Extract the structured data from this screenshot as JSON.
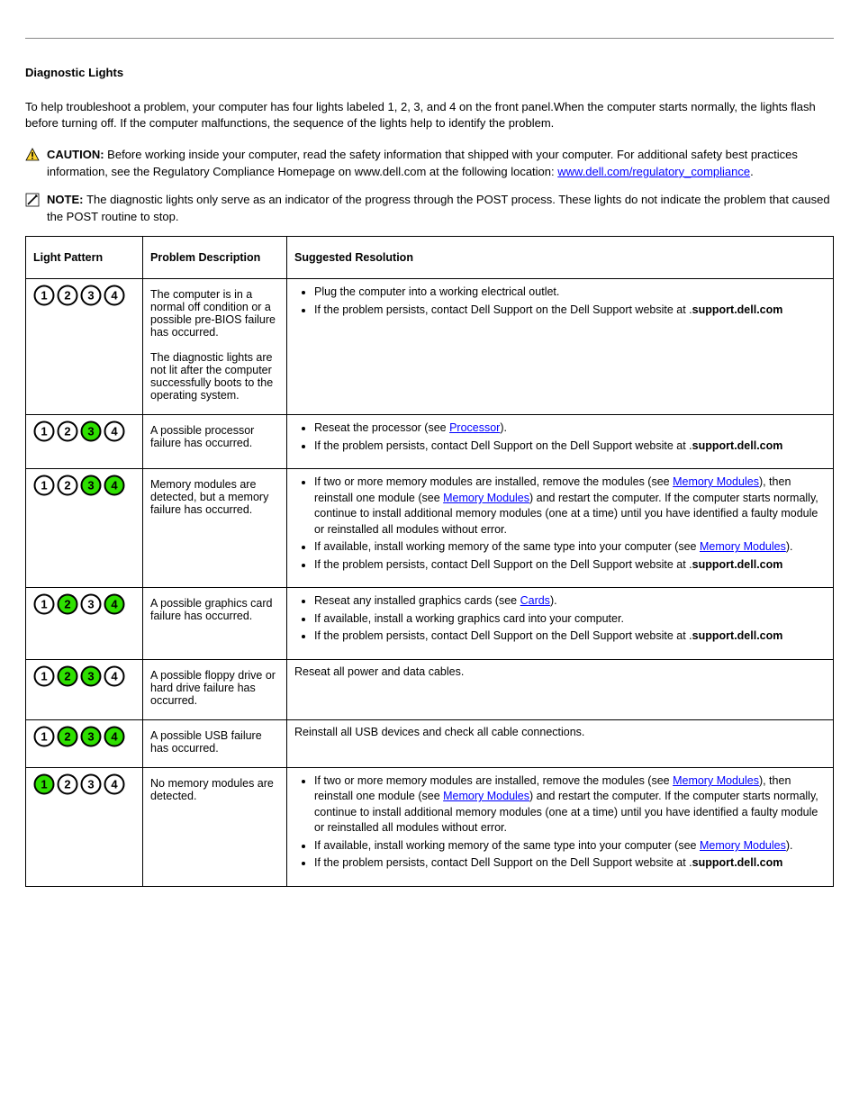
{
  "subtitle": "Diagnostic Lights",
  "lead": "To help troubleshoot a problem, your computer has four lights labeled 1, 2, 3, and 4 on the front panel.When the computer starts normally, the lights flash before turning off. If the computer malfunctions, the sequence of the lights help to identify the problem.",
  "caution": {
    "label": "CAUTION: ",
    "text_before": "Before working inside your computer, read the safety information that shipped with your computer. For additional safety best practices information, see the Regulatory Compliance Homepage on www.dell.com at the following location: ",
    "link": "www.dell.com/regulatory_compliance",
    "after": "."
  },
  "note": {
    "label": "NOTE: ",
    "text": "The diagnostic lights only serve as an indicator of the progress through the POST process. These lights do not indicate the problem that caused the POST routine to stop."
  },
  "headers": {
    "c1": "Light Pattern",
    "c2": "Problem Description",
    "c3": "Suggested Resolution"
  },
  "rows": [
    {
      "lights": [
        0,
        0,
        0,
        0
      ],
      "desc": "The computer is in a normal off condition or a possible pre-BIOS failure has occurred.\n\nThe diagnostic lights are not lit after the computer successfully boots to the operating system.",
      "items": [
        {
          "t": "Plug the computer into a working electrical outlet."
        },
        {
          "t": "If the problem persists, contact Dell Support on the Dell Support website at ",
          "b": "support.dell.com",
          "a": "."
        }
      ]
    },
    {
      "lights": [
        0,
        0,
        1,
        0
      ],
      "desc": "A possible processor failure has occurred.",
      "items": [
        {
          "t": "Reseat the processor (see ",
          "l": "Processor",
          "a": ")."
        },
        {
          "t": "If the problem persists, contact Dell Support on the Dell Support website at ",
          "b": "support.dell.com",
          "a": "."
        }
      ]
    },
    {
      "lights": [
        0,
        0,
        1,
        1
      ],
      "desc": "Memory modules are detected, but a memory failure has occurred.",
      "items": [
        {
          "t": "If two or more memory modules are installed, remove the modules (see ",
          "l": "Memory Modules",
          "a": "), then reinstall one module (see ",
          "l2": "Memory Modules",
          "a2": ") and restart the computer. If the computer starts normally, continue to install additional memory modules (one at a time) until you have identified a faulty module or reinstalled all modules without error."
        },
        {
          "t": "If available, install working memory of the same type into your computer (see ",
          "l": "Memory Modules",
          "a": ")."
        },
        {
          "t": "If the problem persists, contact Dell Support on the Dell Support website at ",
          "b": "support.dell.com",
          "a": "."
        }
      ]
    },
    {
      "lights": [
        0,
        1,
        0,
        1
      ],
      "desc": "A possible graphics card failure has occurred.",
      "items": [
        {
          "t": "Reseat any installed graphics cards (see ",
          "l": "Cards",
          "a": ")."
        },
        {
          "t": "If available, install a working graphics card into your computer."
        },
        {
          "t": "If the problem persists, contact Dell Support on the Dell Support website at ",
          "b": "support.dell.com",
          "a": "."
        }
      ]
    },
    {
      "lights": [
        0,
        1,
        1,
        0
      ],
      "desc": "A possible floppy drive or hard drive failure has occurred.",
      "plain": "Reseat all power and data cables."
    },
    {
      "lights": [
        0,
        1,
        1,
        1
      ],
      "desc": "A possible USB failure has occurred.",
      "plain": "Reinstall all USB devices and check all cable connections."
    },
    {
      "lights": [
        1,
        0,
        0,
        0
      ],
      "desc": "No memory modules are detected.",
      "items": [
        {
          "t": "If two or more memory modules are installed, remove the modules (see ",
          "l": "Memory Modules",
          "a": "), then reinstall one module (see ",
          "l2": "Memory Modules",
          "a2": ") and restart the computer. If the computer starts normally, continue to install additional memory modules (one at a time) until you have identified a faulty module or reinstalled all modules without error."
        },
        {
          "t": "If available, install working memory of the same type into your computer (see ",
          "l": "Memory Modules",
          "a": ")."
        },
        {
          "t": "If the problem persists, contact Dell Support on the Dell Support website at ",
          "b": "support.dell.com",
          "a": "."
        }
      ]
    }
  ]
}
